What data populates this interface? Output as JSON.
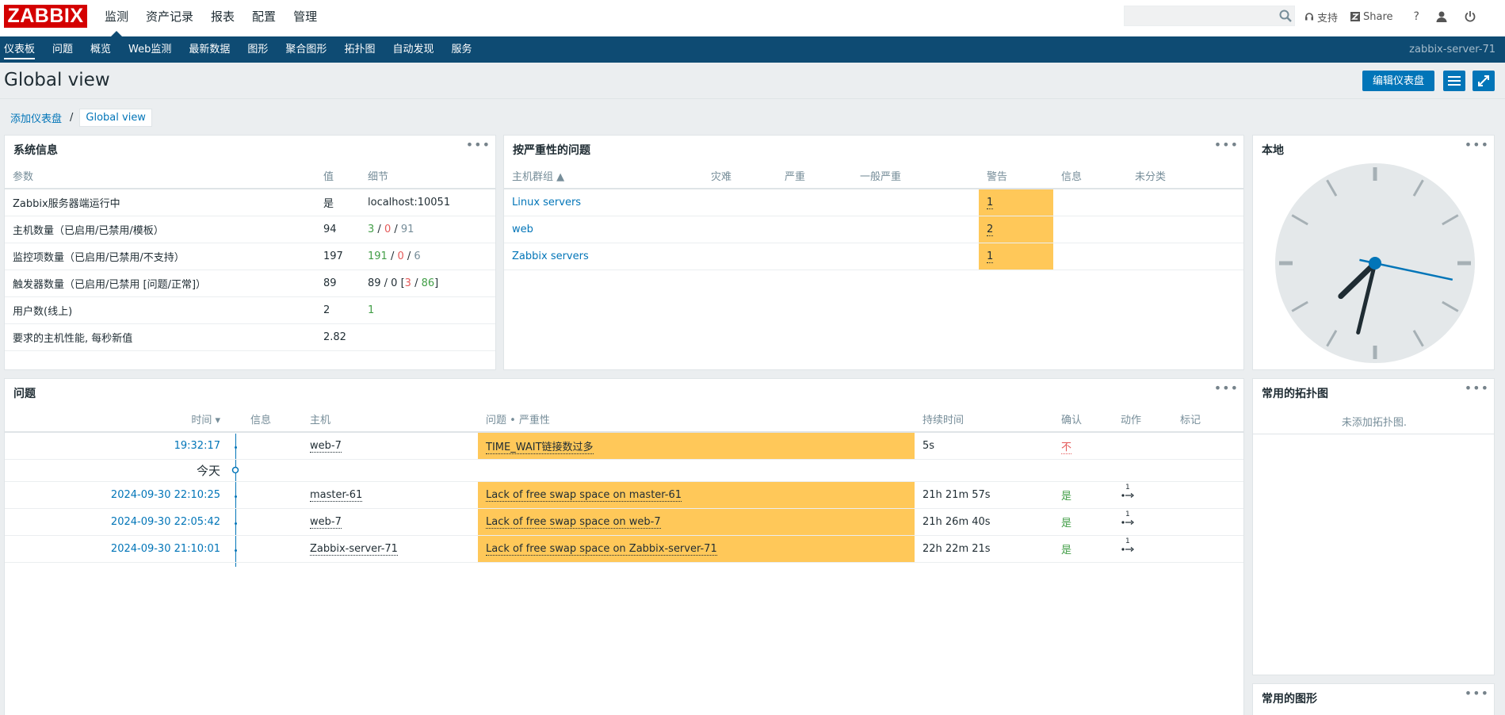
{
  "header": {
    "logo": "ZABBIX",
    "nav": [
      "监测",
      "资产记录",
      "报表",
      "配置",
      "管理"
    ],
    "search_value": "",
    "support": "支持",
    "share": "Share",
    "help": "?"
  },
  "subnav": {
    "items": [
      "仪表板",
      "问题",
      "概览",
      "Web监测",
      "最新数据",
      "图形",
      "聚合图形",
      "拓扑图",
      "自动发现",
      "服务"
    ],
    "server": "zabbix-server-71"
  },
  "page": {
    "title": "Global view",
    "edit_button": "编辑仪表盘"
  },
  "breadcrumb": {
    "parent": "添加仪表盘",
    "separator": "/",
    "current": "Global view"
  },
  "sysinfo": {
    "title": "系统信息",
    "headers": [
      "参数",
      "值",
      "细节"
    ],
    "rows": [
      {
        "param": "Zabbix服务器端运行中",
        "value": "是",
        "detail": "localhost:10051"
      },
      {
        "param": "主机数量（已启用/已禁用/模板）",
        "value": "94",
        "d1": "3",
        "d2": "0",
        "d3": "91"
      },
      {
        "param": "监控项数量（已启用/已禁用/不支持）",
        "value": "197",
        "d1": "191",
        "d2": "0",
        "d3": "6"
      },
      {
        "param": "触发器数量（已启用/已禁用 [问题/正常]）",
        "value": "89",
        "dprefix": "89 / 0 [",
        "d1": "3",
        "d2": "86",
        "dsuffix": "]"
      },
      {
        "param": "用户数(线上)",
        "value": "2",
        "d1": "1"
      },
      {
        "param": "要求的主机性能, 每秒新值",
        "value": "2.82",
        "detail": ""
      }
    ]
  },
  "severity": {
    "title": "按严重性的问题",
    "headers": [
      "主机群组 ▲",
      "灾难",
      "严重",
      "一般严重",
      "警告",
      "信息",
      "未分类"
    ],
    "rows": [
      {
        "group": "Linux servers",
        "warning": "1"
      },
      {
        "group": "web",
        "warning": "2"
      },
      {
        "group": "Zabbix servers",
        "warning": "1"
      }
    ]
  },
  "clock": {
    "title": "本地",
    "hours": 7,
    "minutes": 32,
    "seconds": 17
  },
  "problems": {
    "title": "问题",
    "headers": [
      "时间 ▾",
      "信息",
      "主机",
      "问题 • 严重性",
      "持续时间",
      "确认",
      "动作",
      "标记"
    ],
    "today_label": "今天",
    "rows": [
      {
        "time": "19:32:17",
        "host": "web-7",
        "problem": "TIME_WAIT链接数过多",
        "duration": "5s",
        "ack": "不",
        "action": ""
      },
      {
        "time": "2024-09-30 22:10:25",
        "host": "master-61",
        "problem": "Lack of free swap space on master-61",
        "duration": "21h 21m 57s",
        "ack": "是",
        "action": "1"
      },
      {
        "time": "2024-09-30 22:05:42",
        "host": "web-7",
        "problem": "Lack of free swap space on web-7",
        "duration": "21h 26m 40s",
        "ack": "是",
        "action": "1"
      },
      {
        "time": "2024-09-30 21:10:01",
        "host": "Zabbix-server-71",
        "problem": "Lack of free swap space on Zabbix-server-71",
        "duration": "22h 22m 21s",
        "ack": "是",
        "action": "1"
      }
    ]
  },
  "maps": {
    "title": "常用的拓扑图",
    "empty": "未添加拓扑图."
  },
  "graphs": {
    "title": "常用的图形"
  },
  "colors": {
    "brand": "#d40000",
    "nav": "#0e4b73",
    "link": "#0275b8",
    "warning": "#ffc859",
    "ok": "#429e47",
    "problem": "#e45959"
  }
}
